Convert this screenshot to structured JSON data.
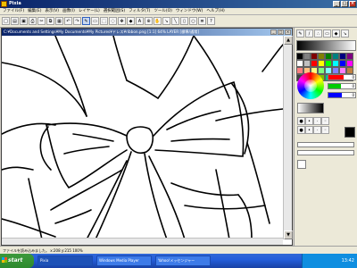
{
  "window": {
    "title": "Pixia",
    "minimize": "_",
    "maximize": "□",
    "close": "×"
  },
  "menu": [
    "ファイル(F)",
    "編集(E)",
    "表示(V)",
    "画像(I)",
    "レイヤー(L)",
    "選択範囲(S)",
    "フィルタ(T)",
    "ツール(O)",
    "ウィンドウ(W)",
    "ヘルプ(H)"
  ],
  "toolbar_icons": [
    "new-icon",
    "open-icon",
    "save-icon",
    "print-icon",
    "cut-icon",
    "copy-icon",
    "paste-icon",
    "undo-icon",
    "redo-icon",
    "pen-icon",
    "eraser-icon",
    "select-icon",
    "lasso-icon",
    "move-icon",
    "fill-icon",
    "text-icon",
    "zoom-icon",
    "hand-icon",
    "eyedropper-icon",
    "line-icon",
    "rect-icon",
    "ellipse-icon",
    "layer-icon",
    "help-icon"
  ],
  "document": {
    "title": "C:¥Documents and Settings¥My Documents¥My Pictures¥ドレス¥ribbon.png [1:1] 64%  LAYER [標準/通常]",
    "min": "_",
    "max": "□",
    "close": "×"
  },
  "palette_colors": [
    "#000000",
    "#808080",
    "#800000",
    "#808000",
    "#008000",
    "#008080",
    "#000080",
    "#800080",
    "#ffffff",
    "#c0c0c0",
    "#ff0000",
    "#ffff00",
    "#00ff00",
    "#00ffff",
    "#0000ff",
    "#ff00ff",
    "#ff8080",
    "#ffc080",
    "#ffff80",
    "#80ff80",
    "#80ffff",
    "#8080ff",
    "#ff80ff",
    "#c08040",
    "#404040",
    "#e0e0e0",
    "#ff8000",
    "#80c000",
    "#00c080",
    "#0080c0",
    "#8000ff",
    "#ff0080"
  ],
  "rgb": {
    "r": "0",
    "g": "0",
    "b": "0"
  },
  "current_color": "#000000",
  "status": "ファイルを読み込みました。 x:208 y:215   100%",
  "taskbar": {
    "start": "start",
    "tasks": [
      "Pixia",
      "Windows Media Player",
      "Yahoo!メッセンジャー"
    ],
    "clock": "13:42"
  }
}
